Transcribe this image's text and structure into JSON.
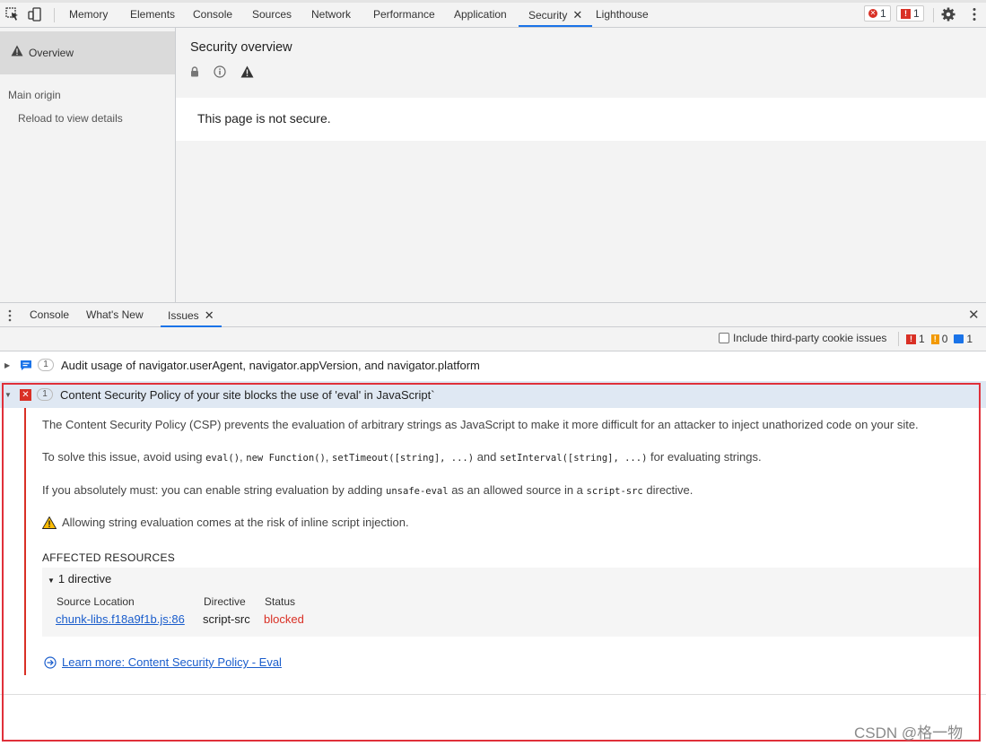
{
  "toolbar": {
    "tabs": [
      "Memory",
      "Elements",
      "Console",
      "Sources",
      "Network",
      "Performance",
      "Application",
      "Security",
      "Lighthouse"
    ],
    "active_tab": "Security",
    "error_count": "1",
    "issue_count": "1"
  },
  "sidebar": {
    "overview": "Overview",
    "main_origin": "Main origin",
    "reload": "Reload to view details"
  },
  "security": {
    "title": "Security overview",
    "status": "This page is not secure."
  },
  "drawer": {
    "tabs": [
      "Console",
      "What's New",
      "Issues"
    ],
    "active_tab": "Issues"
  },
  "issues_toolbar": {
    "include_third_party": "Include third-party cookie issues",
    "error_count": "1",
    "warning_count": "0",
    "info_count": "1"
  },
  "issues": [
    {
      "count": "1",
      "title": "Audit usage of navigator.userAgent, navigator.appVersion, and navigator.platform",
      "icon": "info-message-icon"
    },
    {
      "count": "1",
      "title": "Content Security Policy of your site blocks the use of 'eval' in JavaScript`",
      "icon": "error-square-icon"
    }
  ],
  "issue_detail": {
    "para1": "The Content Security Policy (CSP) prevents the evaluation of arbitrary strings as JavaScript to make it more difficult for an attacker to inject unathorized code on your site.",
    "para2_pre": "To solve this issue, avoid using",
    "code_eval": "eval()",
    "code_newfn": "new Function()",
    "code_settimeout": "setTimeout([string], ...)",
    "word_and": "and",
    "code_setinterval": "setInterval([string], ...)",
    "para2_post": "for evaluating strings.",
    "para3_pre": "If you absolutely must: you can enable string evaluation by adding",
    "code_unsafe": "unsafe-eval",
    "para3_mid": "as an allowed source in a",
    "code_scriptsrc": "script-src",
    "para3_post": "directive.",
    "warning": "Allowing string evaluation comes at the risk of inline script injection.",
    "affected_heading": "AFFECTED RESOURCES",
    "directive_count": "1 directive",
    "col_source": "Source Location",
    "col_directive": "Directive",
    "col_status": "Status",
    "source_link": "chunk-libs.f18a9f1b.js:86",
    "directive_value": "script-src",
    "status_value": "blocked",
    "learn_more": "Learn more: Content Security Policy - Eval"
  },
  "watermark": "CSDN @格一物",
  "colors": {
    "accent": "#1a73e8",
    "error": "#d93025",
    "warning": "#f29900",
    "link": "#1a5dcc"
  }
}
